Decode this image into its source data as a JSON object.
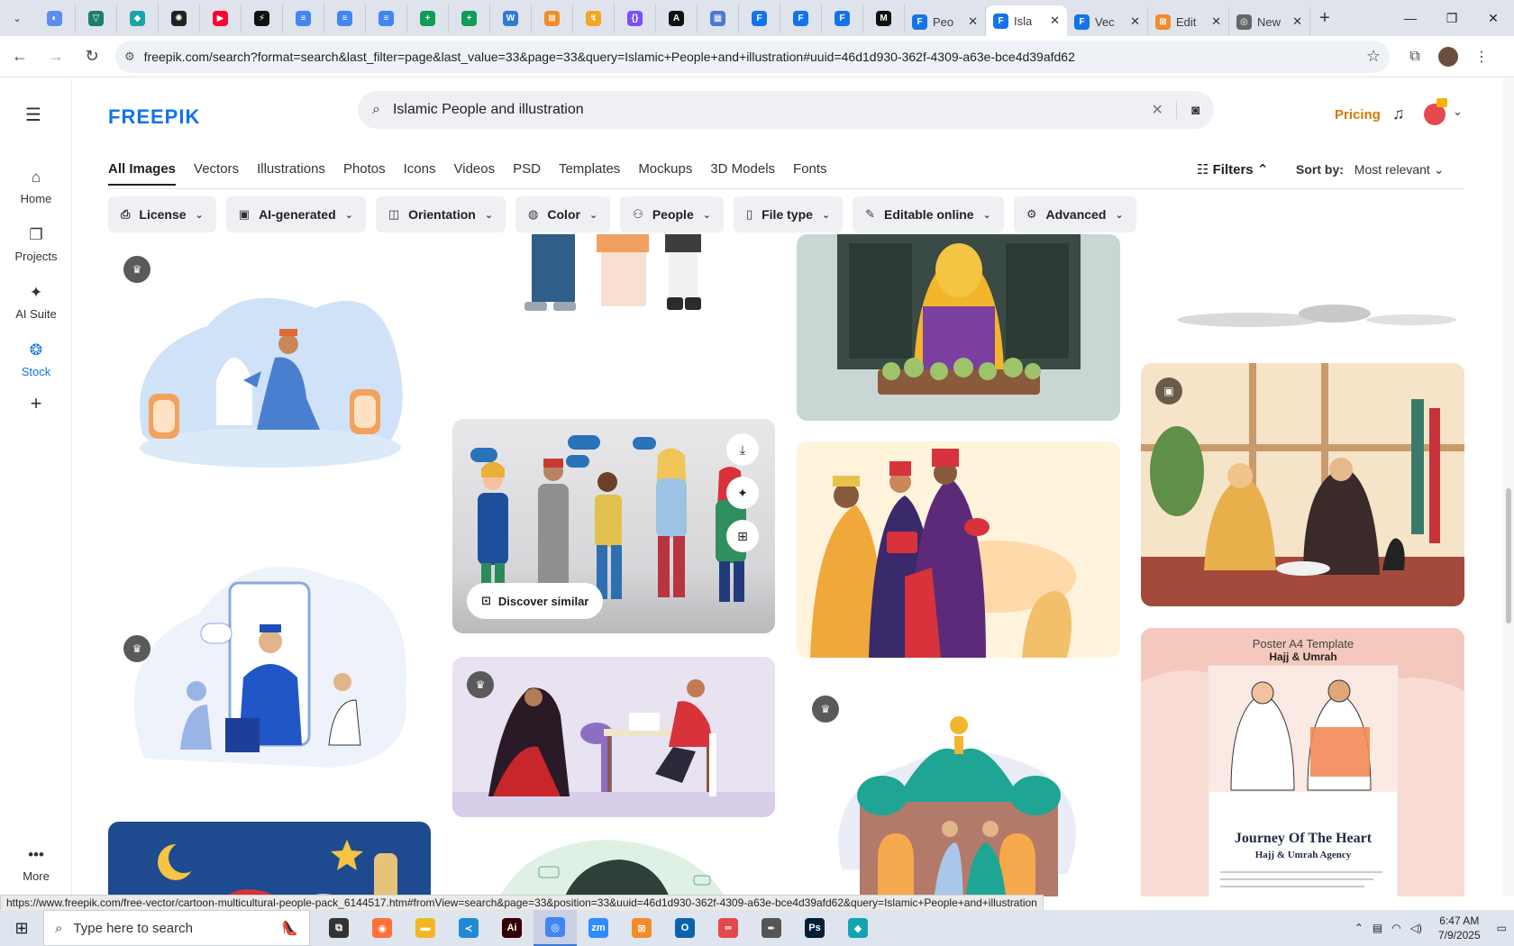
{
  "browser": {
    "pinned_tabs": [
      {
        "icon": "globe-icon",
        "color": "#5b8def",
        "glyph": "◐"
      },
      {
        "icon": "vpn-icon",
        "color": "#1e7b6e",
        "glyph": "▽"
      },
      {
        "icon": "teal-app-icon",
        "color": "#1aa3a8",
        "glyph": "◆"
      },
      {
        "icon": "openai-icon",
        "color": "#222222",
        "glyph": "✺"
      },
      {
        "icon": "youtube-icon",
        "color": "#ff0033",
        "glyph": "▶"
      },
      {
        "icon": "lightning-icon",
        "color": "#111111",
        "glyph": "⚡"
      },
      {
        "icon": "docs-icon",
        "color": "#4285f4",
        "glyph": "≡"
      },
      {
        "icon": "docs-icon",
        "color": "#4285f4",
        "glyph": "≡"
      },
      {
        "icon": "docs-icon",
        "color": "#4285f4",
        "glyph": "≡"
      },
      {
        "icon": "sheets-icon",
        "color": "#0f9d58",
        "glyph": "+"
      },
      {
        "icon": "sheets-icon",
        "color": "#0f9d58",
        "glyph": "+"
      },
      {
        "icon": "word-icon",
        "color": "#2b7cd3",
        "glyph": "W"
      },
      {
        "icon": "orange-box-icon",
        "color": "#f28c28",
        "glyph": "⊠"
      },
      {
        "icon": "arrow-icon",
        "color": "#f5a623",
        "glyph": "↯"
      },
      {
        "icon": "code-icon",
        "color": "#7c4dff",
        "glyph": "{}"
      },
      {
        "icon": "a-icon",
        "color": "#111111",
        "glyph": "A"
      },
      {
        "icon": "grid-icon",
        "color": "#4a7bd0",
        "glyph": "▦"
      },
      {
        "icon": "freepik-icon",
        "color": "#1273eb",
        "glyph": "F"
      },
      {
        "icon": "freepik-icon",
        "color": "#1273eb",
        "glyph": "F"
      },
      {
        "icon": "freepik-icon",
        "color": "#1273eb",
        "glyph": "F"
      },
      {
        "icon": "m-icon",
        "color": "#111111",
        "glyph": "M"
      }
    ],
    "tabs": [
      {
        "title": "Peo",
        "icon": "freepik-icon",
        "active": false
      },
      {
        "title": "Isla",
        "icon": "freepik-icon",
        "active": true
      },
      {
        "title": "Vec",
        "icon": "freepik-icon",
        "active": false
      },
      {
        "title": "Edit",
        "icon": "orange-box-icon",
        "active": false
      },
      {
        "title": "New",
        "icon": "chrome-icon",
        "active": false
      }
    ],
    "url": "freepik.com/search?format=search&last_filter=page&last_value=33&page=33&query=Islamic+People+and+illustration#uuid=46d1d930-362f-4309-a63e-bce4d39afd62",
    "status_link": "https://www.freepik.com/free-vector/cartoon-multicultural-people-pack_6144517.htm#fromView=search&page=33&position=33&uuid=46d1d930-362f-4309-a63e-bce4d39afd62&query=Islamic+People+and+illustration"
  },
  "site": {
    "logo": "FREEPIK",
    "search_value": "Islamic People and illustration",
    "pricing": "Pricing",
    "rail": [
      {
        "label": "Home",
        "icon": "home-icon",
        "glyph": "⌂",
        "active": false
      },
      {
        "label": "Projects",
        "icon": "projects-icon",
        "glyph": "❐",
        "active": false
      },
      {
        "label": "AI Suite",
        "icon": "ai-suite-icon",
        "glyph": "✦",
        "active": false
      },
      {
        "label": "Stock",
        "icon": "stock-icon",
        "glyph": "❂",
        "active": true
      },
      {
        "label": "More",
        "icon": "more-icon",
        "glyph": "•••",
        "active": false
      }
    ],
    "categories": [
      "All Images",
      "Vectors",
      "Illustrations",
      "Photos",
      "Icons",
      "Videos",
      "PSD",
      "Templates",
      "Mockups",
      "3D Models",
      "Fonts"
    ],
    "filters_label": "Filters",
    "sort_label": "Sort by:",
    "sort_value": "Most relevant",
    "chips": [
      {
        "label": "License",
        "icon": "license-icon",
        "glyph": "⎙"
      },
      {
        "label": "AI-generated",
        "icon": "ai-generated-icon",
        "glyph": "▣"
      },
      {
        "label": "Orientation",
        "icon": "orientation-icon",
        "glyph": "◫"
      },
      {
        "label": "Color",
        "icon": "palette-icon",
        "glyph": "◍"
      },
      {
        "label": "People",
        "icon": "people-icon",
        "glyph": "⚇"
      },
      {
        "label": "File type",
        "icon": "file-icon",
        "glyph": "▯"
      },
      {
        "label": "Editable online",
        "icon": "pencil-icon",
        "glyph": "✎"
      },
      {
        "label": "Advanced",
        "icon": "gear-icon",
        "glyph": "⚙"
      }
    ],
    "discover_similar": "Discover similar",
    "poster": {
      "kicker": "Poster A4 Template",
      "subject": "Hajj & Umrah",
      "title": "Journey Of The Heart",
      "agency": "Hajj & Umrah Agency"
    }
  },
  "taskbar": {
    "search_placeholder": "Type here to search",
    "time": "6:47 AM",
    "date": "7/9/2025",
    "apps": [
      {
        "icon": "task-view-icon",
        "color": "#333333",
        "glyph": "⧉",
        "active": false
      },
      {
        "icon": "firefox-icon",
        "color": "#ff7139",
        "glyph": "◉",
        "active": false
      },
      {
        "icon": "file-explorer-icon",
        "color": "#f2b824",
        "glyph": "▬",
        "active": false
      },
      {
        "icon": "vscode-icon",
        "color": "#1f8ad2",
        "glyph": "≺",
        "active": false
      },
      {
        "icon": "illustrator-icon",
        "color": "#330000",
        "glyph": "Ai",
        "active": false
      },
      {
        "icon": "chrome-icon",
        "color": "#4285f4",
        "glyph": "◎",
        "active": true
      },
      {
        "icon": "zoom-icon",
        "color": "#2d8cff",
        "glyph": "zm",
        "active": false
      },
      {
        "icon": "orange-box-icon",
        "color": "#f28c28",
        "glyph": "⊠",
        "active": false
      },
      {
        "icon": "outlook-icon",
        "color": "#0a64ad",
        "glyph": "O",
        "active": false
      },
      {
        "icon": "creative-cloud-icon",
        "color": "#e34850",
        "glyph": "∞",
        "active": false
      },
      {
        "icon": "pen-tool-icon",
        "color": "#555555",
        "glyph": "✒",
        "active": false
      },
      {
        "icon": "photoshop-icon",
        "color": "#001e36",
        "glyph": "Ps",
        "active": false
      },
      {
        "icon": "gem-app-icon",
        "color": "#13a4b4",
        "glyph": "◆",
        "active": false
      }
    ]
  }
}
